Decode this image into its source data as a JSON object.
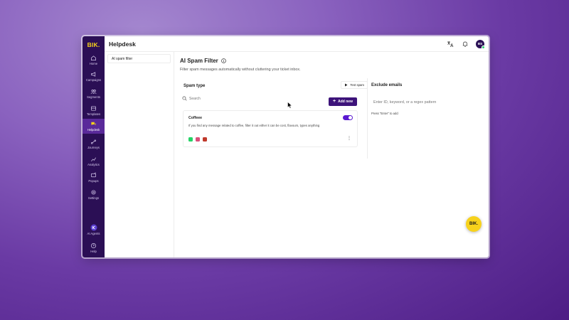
{
  "app": {
    "logo": "BIK.",
    "header_title": "Helpdesk",
    "user_initials": "BS"
  },
  "sidebar": {
    "items": [
      {
        "label": "Home",
        "icon": "home-icon"
      },
      {
        "label": "Campaigns",
        "icon": "megaphone-icon"
      },
      {
        "label": "Segments",
        "icon": "users-icon"
      },
      {
        "label": "Templates",
        "icon": "template-icon"
      },
      {
        "label": "Helpdesk",
        "icon": "chat-icon",
        "active": true
      },
      {
        "label": "Journeys",
        "icon": "journey-icon"
      },
      {
        "label": "Analytics",
        "icon": "chart-icon"
      },
      {
        "label": "Popups",
        "icon": "popup-icon"
      },
      {
        "label": "Settings",
        "icon": "gear-icon"
      }
    ],
    "bottom_items": [
      {
        "label": "AI Agents",
        "icon": "ai-agent-icon"
      },
      {
        "label": "Help",
        "icon": "help-icon"
      }
    ]
  },
  "subnav": {
    "items": [
      {
        "label": "AI spam filter"
      }
    ]
  },
  "page": {
    "title": "AI Spam Filter",
    "subtitle": "Filter spam messages automatically without cluttering your ticket inbox."
  },
  "spam_type": {
    "title": "Spam type",
    "test_label": "Test spam",
    "search_placeholder": "Search",
    "add_label": "Add new",
    "rules": [
      {
        "name": "Coffeee",
        "description": "If you find any message related to coffee, filter it out either it can be cost, flavours, types anything",
        "enabled": true,
        "channels": [
          "whatsapp",
          "instagram",
          "email"
        ]
      }
    ]
  },
  "exclude": {
    "title": "Exclude emails",
    "placeholder": "Enter ID, keyword, or a regex pattern",
    "hint": "Press \"Enter\" to add"
  },
  "colors": {
    "sidebar_bg": "#2b0f55",
    "accent": "#3d137a",
    "toggle_on": "#5b1ad1",
    "logo_yellow": "#f7d21c",
    "whatsapp": "#25d366",
    "instagram": "#d94f7a",
    "email": "#c0392b"
  },
  "fab": {
    "label": "BIK."
  }
}
